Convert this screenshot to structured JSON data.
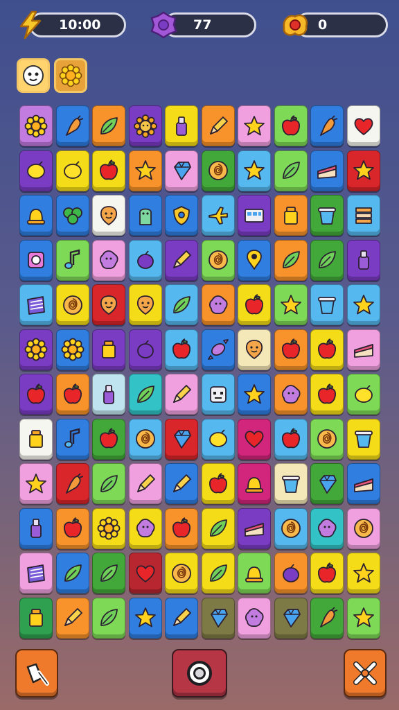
{
  "hud": {
    "timer": {
      "value": "10:00",
      "icon": "lightning-bolt-icon"
    },
    "gems": {
      "value": "77",
      "icon": "purple-gem-icon"
    },
    "coins": {
      "value": "0",
      "icon": "gold-coin-pile-icon"
    }
  },
  "boosters": [
    {
      "icon": "ghost-face-icon",
      "color": "#ffd36e"
    },
    {
      "icon": "sun-flower-icon",
      "color": "#e8a23a"
    }
  ],
  "colors": {
    "P": "#c27ce0",
    "B": "#2f7ee0",
    "O": "#f7932a",
    "V": "#7b3cc4",
    "Y": "#f5dc18",
    "K": "#f0a0de",
    "L": "#55b8ef",
    "G": "#43a83a",
    "W": "#f6f6f0",
    "R": "#d9262a",
    "LG": "#7ed957",
    "TL": "#33c3c6",
    "OL": "#7e7a45",
    "CR": "#f5e8b8",
    "MG": "#d2267c",
    "RD": "#b82630",
    "LL": "#c0e4ef",
    "GR": "#2ea04f"
  },
  "board": {
    "rows": [
      [
        [
          "P",
          "flower"
        ],
        [
          "B",
          "carrot"
        ],
        [
          "O",
          "leaf"
        ],
        [
          "V",
          "sun"
        ],
        [
          "Y",
          "bottle"
        ],
        [
          "O",
          "pencil"
        ],
        [
          "K",
          "star"
        ],
        [
          "LG",
          "apple"
        ],
        [
          "B",
          "carrot"
        ],
        [
          "W",
          "heart"
        ]
      ],
      [
        [
          "V",
          "lemon"
        ],
        [
          "Y",
          "lemon"
        ],
        [
          "Y",
          "apple"
        ],
        [
          "O",
          "star"
        ],
        [
          "K",
          "gem"
        ],
        [
          "G",
          "spiral"
        ],
        [
          "L",
          "star"
        ],
        [
          "LG",
          "leaf"
        ],
        [
          "B",
          "cake"
        ],
        [
          "R",
          "star"
        ]
      ],
      [
        [
          "B",
          "bell"
        ],
        [
          "B",
          "clover"
        ],
        [
          "W",
          "face"
        ],
        [
          "B",
          "ghost"
        ],
        [
          "B",
          "shield"
        ],
        [
          "L",
          "plane"
        ],
        [
          "V",
          "cart"
        ],
        [
          "O",
          "jar"
        ],
        [
          "G",
          "cup"
        ],
        [
          "L",
          "stack"
        ]
      ],
      [
        [
          "B",
          "clock"
        ],
        [
          "LG",
          "note"
        ],
        [
          "K",
          "blob"
        ],
        [
          "L",
          "plum"
        ],
        [
          "V",
          "pencil"
        ],
        [
          "LG",
          "spiral"
        ],
        [
          "B",
          "pin"
        ],
        [
          "O",
          "leaf"
        ],
        [
          "G",
          "leaf"
        ],
        [
          "V",
          "bottle"
        ]
      ],
      [
        [
          "L",
          "book"
        ],
        [
          "Y",
          "spiral"
        ],
        [
          "R",
          "face"
        ],
        [
          "Y",
          "face"
        ],
        [
          "L",
          "leaf"
        ],
        [
          "O",
          "blob"
        ],
        [
          "Y",
          "apple"
        ],
        [
          "LG",
          "star"
        ],
        [
          "L",
          "cup"
        ],
        [
          "L",
          "star"
        ]
      ],
      [
        [
          "V",
          "flower"
        ],
        [
          "B",
          "flower"
        ],
        [
          "V",
          "jar"
        ],
        [
          "V",
          "plum"
        ],
        [
          "L",
          "apple"
        ],
        [
          "B",
          "candy"
        ],
        [
          "CR",
          "face"
        ],
        [
          "O",
          "apple"
        ],
        [
          "Y",
          "apple"
        ],
        [
          "K",
          "cake"
        ]
      ],
      [
        [
          "V",
          "apple"
        ],
        [
          "O",
          "apple"
        ],
        [
          "LL",
          "bottle"
        ],
        [
          "TL",
          "leaf"
        ],
        [
          "K",
          "pencil"
        ],
        [
          "L",
          "robot"
        ],
        [
          "B",
          "star"
        ],
        [
          "O",
          "blob"
        ],
        [
          "Y",
          "apple"
        ],
        [
          "LG",
          "lemon"
        ]
      ],
      [
        [
          "W",
          "jar"
        ],
        [
          "B",
          "note"
        ],
        [
          "G",
          "apple"
        ],
        [
          "L",
          "spiral"
        ],
        [
          "R",
          "gem"
        ],
        [
          "L",
          "lemon"
        ],
        [
          "MG",
          "heart"
        ],
        [
          "L",
          "apple"
        ],
        [
          "LG",
          "spiral"
        ],
        [
          "Y",
          "cup"
        ]
      ],
      [
        [
          "K",
          "star"
        ],
        [
          "R",
          "carrot"
        ],
        [
          "LG",
          "leaf"
        ],
        [
          "K",
          "pencil"
        ],
        [
          "B",
          "pencil"
        ],
        [
          "Y",
          "apple"
        ],
        [
          "MG",
          "bell"
        ],
        [
          "CR",
          "cup"
        ],
        [
          "G",
          "gem"
        ],
        [
          "B",
          "cake"
        ]
      ],
      [
        [
          "B",
          "bottle"
        ],
        [
          "O",
          "apple"
        ],
        [
          "Y",
          "flower"
        ],
        [
          "Y",
          "blob"
        ],
        [
          "O",
          "apple"
        ],
        [
          "Y",
          "leaf"
        ],
        [
          "V",
          "cake"
        ],
        [
          "L",
          "spiral"
        ],
        [
          "TL",
          "blob"
        ],
        [
          "K",
          "spiral"
        ]
      ],
      [
        [
          "K",
          "book"
        ],
        [
          "B",
          "leaf"
        ],
        [
          "G",
          "leaf"
        ],
        [
          "RD",
          "heart"
        ],
        [
          "Y",
          "spiral"
        ],
        [
          "Y",
          "leaf"
        ],
        [
          "LG",
          "bell"
        ],
        [
          "O",
          "plum"
        ],
        [
          "Y",
          "apple"
        ],
        [
          "Y",
          "star"
        ]
      ],
      [
        [
          "GR",
          "jar"
        ],
        [
          "O",
          "pencil"
        ],
        [
          "LG",
          "leaf"
        ],
        [
          "B",
          "star"
        ],
        [
          "B",
          "pencil"
        ],
        [
          "OL",
          "gem"
        ],
        [
          "K",
          "blob"
        ],
        [
          "OL",
          "gem"
        ],
        [
          "G",
          "carrot"
        ],
        [
          "LG",
          "star"
        ]
      ]
    ]
  },
  "bottom": {
    "left": {
      "icon": "broom-icon"
    },
    "center": {
      "icon": "target-ring-icon"
    },
    "right": {
      "icon": "crossed-tools-icon"
    }
  }
}
